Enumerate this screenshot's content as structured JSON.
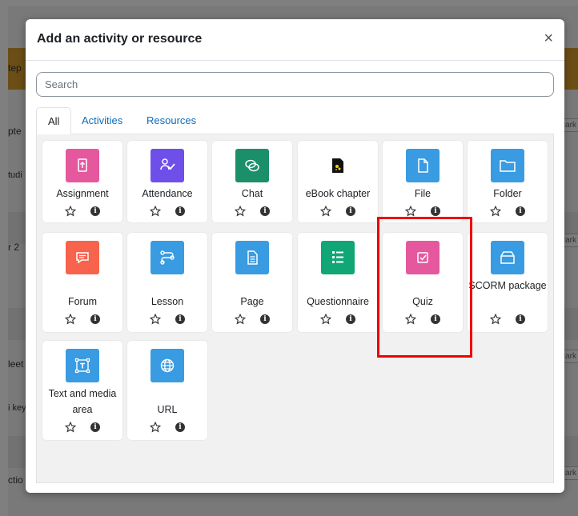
{
  "modal": {
    "title": "Add an activity or resource",
    "close": "×",
    "search_placeholder": "Search"
  },
  "tabs": [
    {
      "label": "All",
      "active": true
    },
    {
      "label": "Activities",
      "active": false
    },
    {
      "label": "Resources",
      "active": false
    }
  ],
  "items": [
    {
      "label": "Assignment",
      "icon": "assignment-icon",
      "color": "#e5589e"
    },
    {
      "label": "Attendance",
      "icon": "attendance-icon",
      "color": "#6f4fea"
    },
    {
      "label": "Chat",
      "icon": "chat-icon",
      "color": "#1a8f6a"
    },
    {
      "label": "eBook chapter",
      "icon": "ebook-icon",
      "color": "#ffffff"
    },
    {
      "label": "File",
      "icon": "file-icon",
      "color": "#399be2"
    },
    {
      "label": "Folder",
      "icon": "folder-icon",
      "color": "#399be2"
    },
    {
      "label": "Forum",
      "icon": "forum-icon",
      "color": "#f7634d"
    },
    {
      "label": "Lesson",
      "icon": "lesson-icon",
      "color": "#399be2"
    },
    {
      "label": "Page",
      "icon": "page-icon",
      "color": "#399be2"
    },
    {
      "label": "Questionnaire",
      "icon": "questionnaire-icon",
      "color": "#11a676"
    },
    {
      "label": "Quiz",
      "icon": "quiz-icon",
      "color": "#e5589e"
    },
    {
      "label": "SCORM package",
      "icon": "scorm-icon",
      "color": "#399be2"
    },
    {
      "label": "Text and media area",
      "icon": "text-media-icon",
      "color": "#399be2"
    },
    {
      "label": "URL",
      "icon": "url-icon",
      "color": "#399be2"
    }
  ],
  "background_fragments": [
    {
      "text": "tep"
    },
    {
      "text": "pte"
    },
    {
      "text": "tudi"
    },
    {
      "text": "r 2"
    },
    {
      "text": "leet"
    },
    {
      "text": "i key"
    },
    {
      "text": "ctio"
    },
    {
      "text": "Mark"
    },
    {
      "text": "Mark"
    },
    {
      "text": "Mark"
    },
    {
      "text": "Mark"
    }
  ]
}
